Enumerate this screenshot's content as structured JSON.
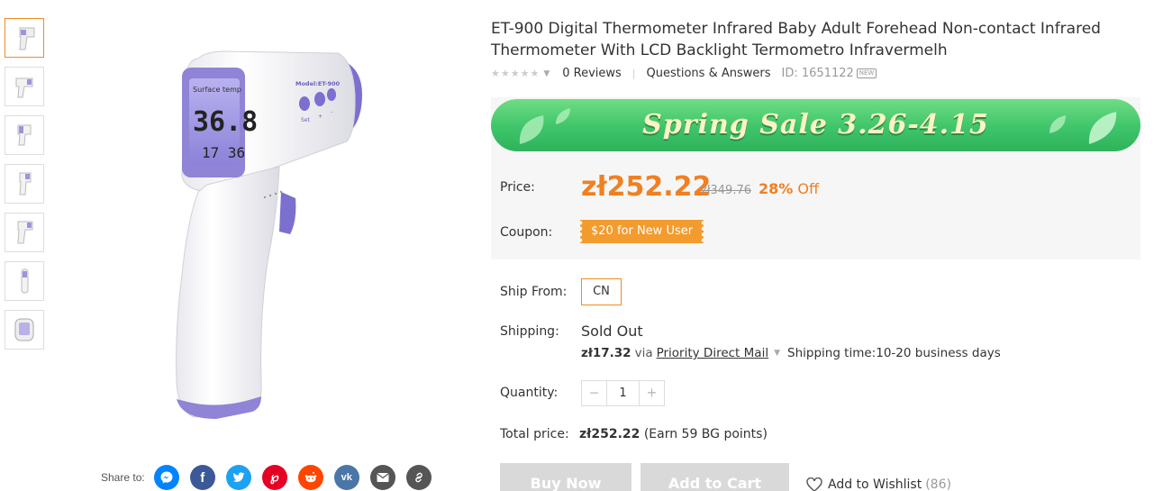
{
  "product": {
    "title": "ET-900 Digital Thermometer Infrared Baby Adult Forehead Non-contact Infrared Thermometer With LCD Backlight Termometro Infravermelh",
    "stars": "★★★★★",
    "reviews": "0 Reviews",
    "qa": "Questions & Answers",
    "id_label": "ID: 1651122",
    "new_badge": "NEW",
    "device": {
      "lcd_label": "Surface temp",
      "lcd_main": "36.8",
      "lcd_small": "17 36",
      "model": "Model:ET-900",
      "set_label": "Set"
    }
  },
  "thumbnails": [
    {
      "name": "thumb-1",
      "active": true
    },
    {
      "name": "thumb-2",
      "active": false
    },
    {
      "name": "thumb-3",
      "active": false
    },
    {
      "name": "thumb-4",
      "active": false
    },
    {
      "name": "thumb-5",
      "active": false
    },
    {
      "name": "thumb-6",
      "active": false
    },
    {
      "name": "thumb-7",
      "active": false
    }
  ],
  "share": {
    "label": "Share to:",
    "buttons": [
      {
        "icon": "messenger-icon",
        "color": "#0084ff",
        "glyph": "✆"
      },
      {
        "icon": "facebook-icon",
        "color": "#3b5998",
        "glyph": "f"
      },
      {
        "icon": "twitter-icon",
        "color": "#1da1f2",
        "glyph": "t"
      },
      {
        "icon": "pinterest-icon",
        "color": "#e60023",
        "glyph": "P"
      },
      {
        "icon": "reddit-icon",
        "color": "#ff4500",
        "glyph": "r"
      },
      {
        "icon": "vk-icon",
        "color": "#4a76a8",
        "glyph": "vk"
      },
      {
        "icon": "email-icon",
        "color": "#555555",
        "glyph": "✉"
      },
      {
        "icon": "link-icon",
        "color": "#555555",
        "glyph": "⛓"
      }
    ]
  },
  "sale": {
    "banner_text": "Spring Sale 3.26-4.15"
  },
  "price": {
    "label": "Price:",
    "current": "zł252.22",
    "original": "zł349.76",
    "discount_pct": "28%",
    "discount_word": " Off"
  },
  "coupon": {
    "label": "Coupon:",
    "text": "$20 for New User"
  },
  "ship_from": {
    "label": "Ship From:",
    "value": "CN"
  },
  "shipping": {
    "label": "Shipping:",
    "status": "Sold Out",
    "cost": "zł17.32",
    "via": "via",
    "method": "Priority Direct Mail",
    "time": "Shipping time:10-20 business days"
  },
  "quantity": {
    "label": "Quantity:",
    "value": "1",
    "minus": "−",
    "plus": "+"
  },
  "total": {
    "label": "Total price:",
    "value": "zł252.22",
    "points": " (Earn 59 BG points)"
  },
  "actions": {
    "buy_now": "Buy Now",
    "add_to_cart": "Add to Cart",
    "wishlist": "Add to Wishlist",
    "wishlist_count": "(86)"
  },
  "colors": {
    "accent": "#f08022",
    "sale_green": "#3ec46a",
    "purple": "#8f84d6"
  }
}
